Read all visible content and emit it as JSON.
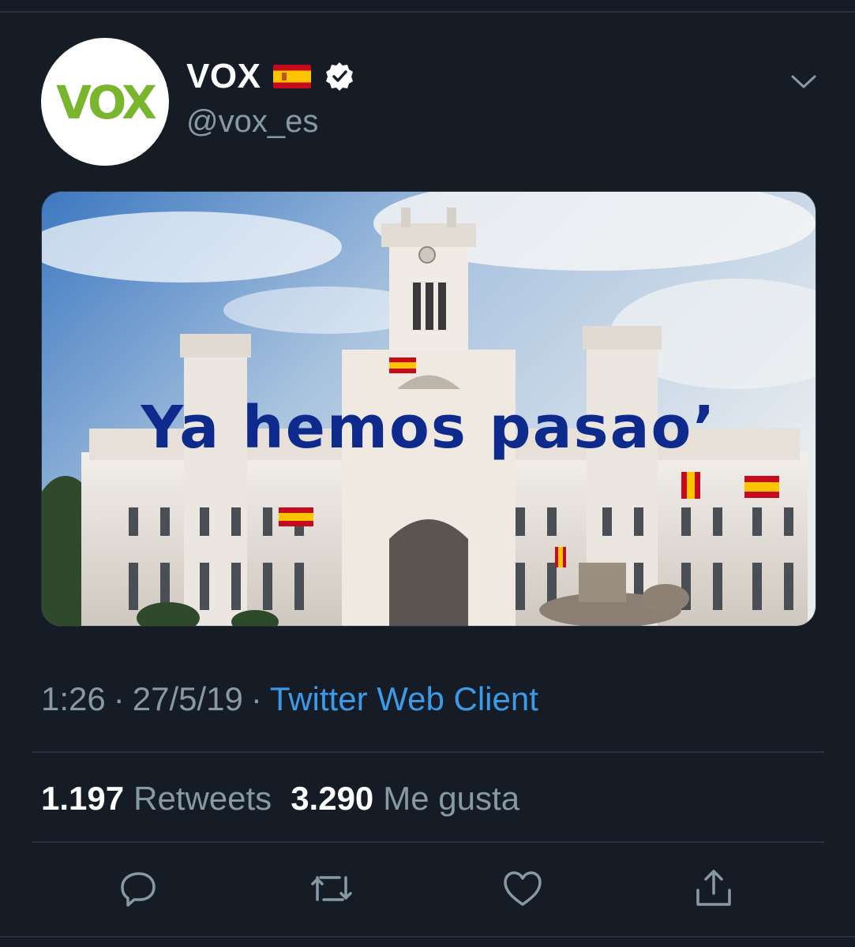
{
  "user": {
    "display_name": "VOX",
    "handle": "@vox_es",
    "avatar_text": "VOX",
    "verified": true,
    "flag": "spain-flag-icon"
  },
  "media": {
    "overlay_text": "Ya hemos pasao’"
  },
  "meta": {
    "time": "1:26",
    "separator": "·",
    "date": "27/5/19",
    "client": "Twitter Web Client"
  },
  "stats": {
    "retweets_count": "1.197",
    "retweets_label": "Retweets",
    "likes_count": "3.290",
    "likes_label": "Me gusta"
  },
  "actions": [
    "reply-icon",
    "retweet-icon",
    "like-icon",
    "share-icon"
  ],
  "colors": {
    "background": "#151c26",
    "secondary_text": "#8899a6",
    "link": "#3b9be8",
    "brand_green": "#7ab52e",
    "overlay_text": "#0e2a8c"
  }
}
